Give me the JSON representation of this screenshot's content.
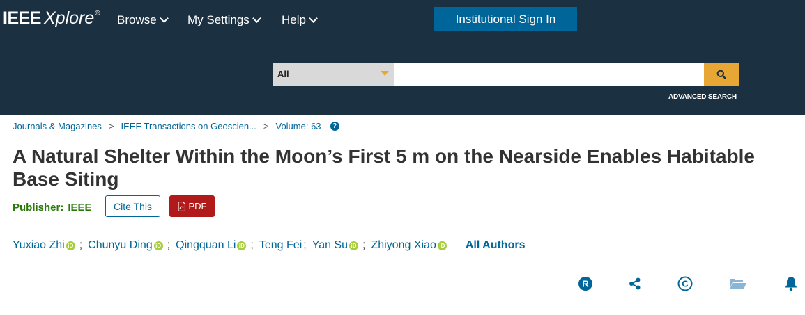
{
  "header": {
    "logo_main": "IEEE",
    "logo_sub": "Xplore",
    "logo_reg": "®",
    "nav": {
      "browse": "Browse",
      "settings": "My Settings",
      "help": "Help"
    },
    "signin": "Institutional Sign In"
  },
  "search": {
    "scope": "All",
    "placeholder": "",
    "value": "",
    "advanced": "ADVANCED SEARCH"
  },
  "breadcrumb": {
    "items": [
      "Journals & Magazines",
      "IEEE Transactions on Geoscien...",
      "Volume: 63"
    ],
    "separator": ">"
  },
  "article": {
    "title": "A Natural Shelter Within the Moon’s First 5 m on the Nearside Enables Habitable Base Siting",
    "publisher_label": "Publisher:",
    "publisher_value": "IEEE",
    "cite_label": "Cite This",
    "pdf_label": "PDF"
  },
  "authors": {
    "names": [
      "Yuxiao Zhi",
      "Chunyu Ding",
      "Qingquan Li",
      "Teng Fei",
      "Yan Su",
      "Zhiyong Xiao"
    ],
    "separator": ";",
    "orcid_badge": "iD",
    "all_label": "All Authors"
  },
  "icons": {
    "accent": "#006699",
    "rights": "R",
    "copyright": "©"
  },
  "colors": {
    "header_bg": "#1b3040",
    "accent_blue": "#006699",
    "search_button": "#e8a735",
    "publisher_green": "#2a7a08",
    "pdf_red": "#b01a1a",
    "orcid_green": "#a6ce39"
  }
}
